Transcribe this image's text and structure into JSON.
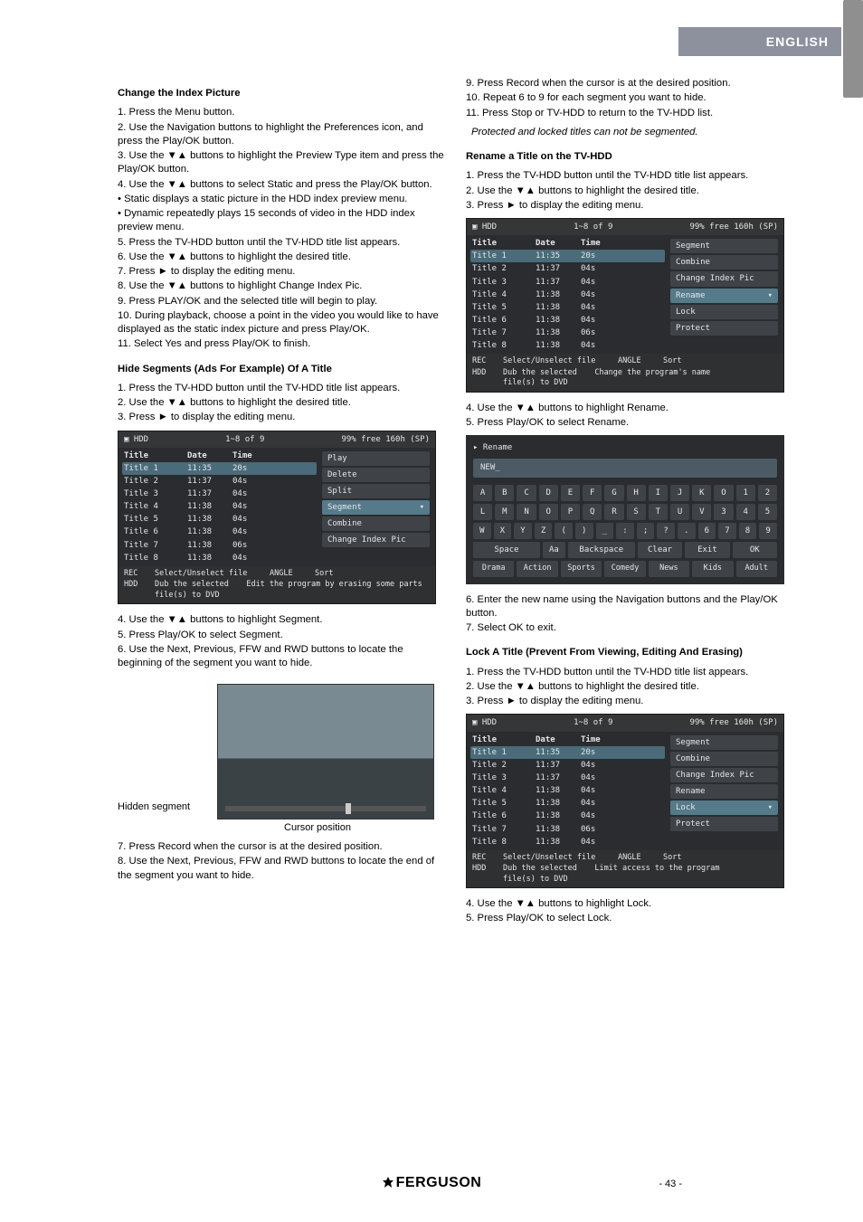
{
  "header": {
    "language": "ENGLISH"
  },
  "footer": {
    "brand": "FERGUSON",
    "page_no": "- 43 -"
  },
  "left": {
    "h1": "Change the Index Picture",
    "p1": "1. Press the Menu button.",
    "p2": "2. Use the Navigation buttons to highlight the Preferences icon, and press the Play/OK button.",
    "p3": "3. Use the ▼▲ buttons to highlight the Preview Type item and press the Play/OK button.",
    "p4": "4. Use the ▼▲ buttons to select Static and press the Play/OK button.",
    "p5": "• Static displays a static picture in the HDD index preview menu.",
    "p6": "• Dynamic repeatedly plays 15 seconds of video in the HDD index preview menu.",
    "p7": "5. Press the TV-HDD button until the TV-HDD title list appears.",
    "p8": "6. Use the ▼▲ buttons to highlight the desired title.",
    "p9": "7. Press ► to display the editing menu.",
    "p10": "8. Use the ▼▲ buttons to highlight Change Index Pic.",
    "p11": "9. Press PLAY/OK and the selected title will begin to play.",
    "p12": "10. During playback, choose a point in the video you would like to have displayed as the static index picture and press Play/OK.",
    "p13": "11. Select Yes and press Play/OK to finish.",
    "h2": "Hide Segments (Ads For Example) Of A Title",
    "q1": "1. Press the TV-HDD button until the TV-HDD title list appears.",
    "q2": "2. Use the ▼▲ buttons to highlight the desired title.",
    "q3": "3. Press ► to display the editing menu.",
    "osd1": {
      "header_left": "HDD",
      "header_mid": "1~8  of 9",
      "header_right": "99% free 160h (SP)",
      "cols": [
        "Title",
        "Date",
        "Time"
      ],
      "rows": [
        [
          "Title 1",
          "11:35",
          "20s"
        ],
        [
          "Title 2",
          "11:37",
          "04s"
        ],
        [
          "Title 3",
          "11:37",
          "04s"
        ],
        [
          "Title 4",
          "11:38",
          "04s"
        ],
        [
          "Title 5",
          "11:38",
          "04s"
        ],
        [
          "Title 6",
          "11:38",
          "04s"
        ],
        [
          "Title 7",
          "11:38",
          "06s"
        ],
        [
          "Title 8",
          "11:38",
          "04s"
        ]
      ],
      "side": [
        "Play",
        "Delete",
        "Split",
        "Segment",
        "Combine",
        "Change Index Pic"
      ],
      "side_sel": 3,
      "foot1": [
        "REC",
        "Select/Unselect file",
        "ANGLE",
        "Sort"
      ],
      "foot2": [
        "HDD",
        "Dub the selected file(s) to DVD",
        "Edit the program by erasing some parts"
      ]
    },
    "r1": "4. Use the ▼▲ buttons to highlight Segment.",
    "r2": "5. Press Play/OK to select Segment.",
    "r3": "6. Use the Next, Previous, FFW and RWD buttons to locate the beginning of the segment you want to hide.",
    "fig_hidden": "Hidden segment",
    "fig_cursor": "Cursor position",
    "s1": "7. Press Record when the cursor is at the desired position.",
    "s2": "8. Use the Next, Previous, FFW and RWD buttons to locate the end of the segment you want to hide."
  },
  "right": {
    "t1": "9. Press Record when the cursor is at the desired position.",
    "t2": "10. Repeat 6 to 9 for each segment you want to hide.",
    "t3": "11. Press Stop or TV-HDD to return to the TV-HDD list.",
    "note": "Protected and locked titles can not be segmented.",
    "h3": "Rename a Title on the TV-HDD",
    "u1": "1. Press the TV-HDD button until the TV-HDD title list appears.",
    "u2": "2. Use the ▼▲ buttons to highlight the desired title.",
    "u3": "3. Press ► to display the editing menu.",
    "osd2": {
      "header_left": "HDD",
      "header_mid": "1~8  of 9",
      "header_right": "99% free 160h (SP)",
      "cols": [
        "Title",
        "Date",
        "Time"
      ],
      "rows": [
        [
          "Title 1",
          "11:35",
          "20s"
        ],
        [
          "Title 2",
          "11:37",
          "04s"
        ],
        [
          "Title 3",
          "11:37",
          "04s"
        ],
        [
          "Title 4",
          "11:38",
          "04s"
        ],
        [
          "Title 5",
          "11:38",
          "04s"
        ],
        [
          "Title 6",
          "11:38",
          "04s"
        ],
        [
          "Title 7",
          "11:38",
          "06s"
        ],
        [
          "Title 8",
          "11:38",
          "04s"
        ]
      ],
      "side": [
        "Segment",
        "Combine",
        "Change Index Pic",
        "Rename",
        "Lock",
        "Protect"
      ],
      "side_sel": 3,
      "foot1": [
        "REC",
        "Select/Unselect file",
        "ANGLE",
        "Sort"
      ],
      "foot2": [
        "HDD",
        "Dub the selected file(s) to DVD",
        "Change the program's name"
      ]
    },
    "v1": "4. Use the ▼▲ buttons to highlight Rename.",
    "v2": "5. Press Play/OK to select Rename.",
    "kbd": {
      "title": "Rename",
      "field": "NEW_",
      "row1": [
        "A",
        "B",
        "C",
        "D",
        "E",
        "F",
        "G",
        "H",
        "I",
        "J",
        "K",
        "O",
        "1",
        "2"
      ],
      "row2": [
        "L",
        "M",
        "N",
        "O",
        "P",
        "Q",
        "R",
        "S",
        "T",
        "U",
        "V",
        "3",
        "4",
        "5"
      ],
      "row3": [
        "W",
        "X",
        "Y",
        "Z",
        "(",
        ")",
        "_",
        ":",
        ";",
        "?",
        ".",
        "6",
        "7",
        "8",
        "9"
      ],
      "row4": [
        "Space",
        "Aa",
        "Backspace",
        "Clear",
        "Exit",
        "OK"
      ],
      "genres": [
        "Drama",
        "Action",
        "Sports",
        "Comedy",
        "News",
        "Kids",
        "Adult"
      ]
    },
    "w1": "6. Enter the new name using the Navigation buttons and the Play/OK button.",
    "w2": "7. Select OK to exit.",
    "h4": "Lock A Title (Prevent From Viewing, Editing And Erasing)",
    "x1": "1. Press the TV-HDD button until the TV-HDD title list appears.",
    "x2": "2. Use the ▼▲ buttons to highlight the desired title.",
    "x3": "3. Press ► to display the editing menu.",
    "osd3": {
      "header_left": "HDD",
      "header_mid": "1~8  of 9",
      "header_right": "99% free 160h (SP)",
      "cols": [
        "Title",
        "Date",
        "Time"
      ],
      "rows": [
        [
          "Title 1",
          "11:35",
          "20s"
        ],
        [
          "Title 2",
          "11:37",
          "04s"
        ],
        [
          "Title 3",
          "11:37",
          "04s"
        ],
        [
          "Title 4",
          "11:38",
          "04s"
        ],
        [
          "Title 5",
          "11:38",
          "04s"
        ],
        [
          "Title 6",
          "11:38",
          "04s"
        ],
        [
          "Title 7",
          "11:38",
          "06s"
        ],
        [
          "Title 8",
          "11:38",
          "04s"
        ]
      ],
      "side": [
        "Segment",
        "Combine",
        "Change Index Pic",
        "Rename",
        "Lock",
        "Protect"
      ],
      "side_sel": 4,
      "foot1": [
        "REC",
        "Select/Unselect file",
        "ANGLE",
        "Sort"
      ],
      "foot2": [
        "HDD",
        "Dub the selected file(s) to DVD",
        "Limit access to the program"
      ]
    },
    "y1": "4. Use the ▼▲ buttons to highlight Lock.",
    "y2": "5. Press Play/OK to select Lock."
  }
}
